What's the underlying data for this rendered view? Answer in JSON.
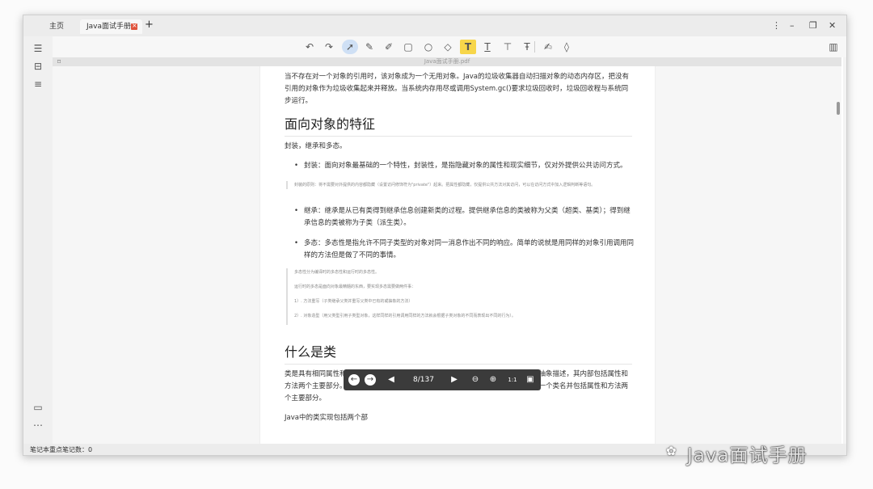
{
  "tabs": {
    "home": "主页",
    "doc": "Java面试手册",
    "add": "+"
  },
  "window_controls": {
    "menu": "⋮",
    "minimize": "–",
    "restore": "❐",
    "close": "✕"
  },
  "viewer": {
    "doc_title": "Java面试手册.pdf",
    "bookmark": "⌑"
  },
  "content": {
    "para1": "当不存在对一个对象的引用时，该对象成为一个无用对象。Java的垃圾收集器自动扫描对象的动态内存区，把没有引用的对象作为垃圾收集起来并释放。当系统内存用尽或调用System.gc()要求垃圾回收时，垃圾回收程与系统同步运行。",
    "h1": "面向对象的特征",
    "para2": "封装，继承和多态。",
    "li1": "封装：面向对象最基础的一个特性，封装性，是指隐藏对象的属性和现实细节，仅对外提供公共访问方式。",
    "quote1": "封装的原则：将不需要对外提供的内容都隐藏（设置访问修饰符为\"private\"）起来。把属性都隐藏，仅提供公共方法对其访问，可以在访问方式中加入逻辑判断等语句。",
    "li2": "继承：继承是从已有类得到继承信息创建新类的过程。提供继承信息的类被称为父类（超类、基类）；得到继承信息的类被称为子类（派生类）。",
    "li3": "多态：多态性是指允许不同子类型的对象对同一消息作出不同的响应。简单的说就是用同样的对象引用调用同样的方法但是做了不同的事情。",
    "quote2a": "多态性分为编译时的多态性和运行时的多态性。",
    "quote2b": "运行时的多态是面向对象最精髓的东西，要实现多态需要做两件事：",
    "quote2c": "1）. 方法重写（子类继承父类并重写父类中已有的或抽象的方法）",
    "quote2d": "2）. 对象造型（用父类型引用子类型对象，这样同样的引用调用同样的方法就会根据子类对象的不同而表现出不同的行为）。",
    "h2": "什么是类",
    "para3": "类是具有相同属性和方法的一组对象的集合，它为属于该类的所有对象提供了统一的抽象描述，其内部包括属性和方法两个主要部分。在面向对象的编程语言中，类是一个独立的程序单位，它应该有一个类名并包括属性和方法两个主要部分。",
    "para4": "Java中的类实现包括两个部"
  },
  "nav": {
    "page": "8/137"
  },
  "status": {
    "notes": "笔记本重点笔记数：0"
  },
  "watermark": "Java面试手册"
}
